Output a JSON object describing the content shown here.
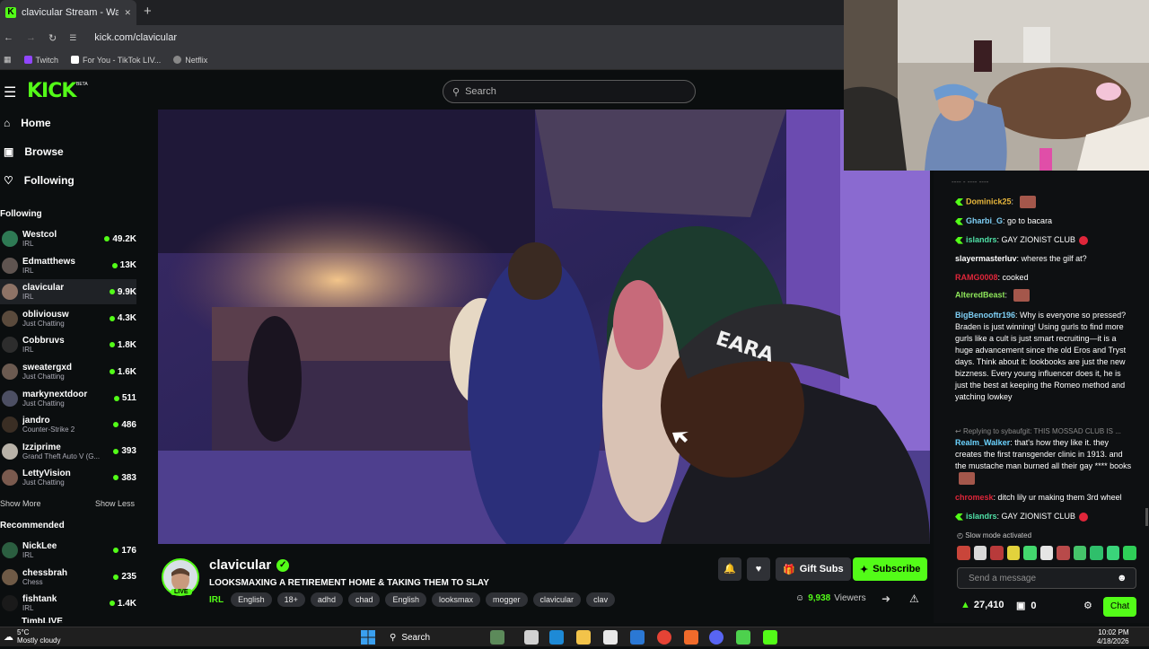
{
  "browser": {
    "tab_title": "clavicular Stream - Watch L",
    "tab_close": "✕",
    "new_tab": "+",
    "url": "kick.com/clavicular",
    "bookmarks": [
      {
        "label": "Twitch",
        "color": "#9146ff"
      },
      {
        "label": "For You - TikTok LIV...",
        "color": "#ffffff"
      },
      {
        "label": "Netflix",
        "color": "#888888"
      }
    ]
  },
  "header": {
    "logo": "KICK",
    "beta": "BETA",
    "search_placeholder": "Search"
  },
  "sidebar": {
    "nav": [
      {
        "label": "Home",
        "icon": "home-icon"
      },
      {
        "label": "Browse",
        "icon": "browse-icon"
      },
      {
        "label": "Following",
        "icon": "heart-icon"
      }
    ],
    "following_title": "Following",
    "following": [
      {
        "name": "Westcol",
        "category": "IRL",
        "viewers": "49.2K",
        "color": "#2e7a54"
      },
      {
        "name": "Edmatthews",
        "category": "IRL",
        "viewers": "13K",
        "color": "#5f5450"
      },
      {
        "name": "clavicular",
        "category": "IRL",
        "viewers": "9.9K",
        "color": "#8e7366"
      },
      {
        "name": "obliviousw",
        "category": "Just Chatting",
        "viewers": "4.3K",
        "color": "#5a4a3c"
      },
      {
        "name": "Cobbruvs",
        "category": "IRL",
        "viewers": "1.8K",
        "color": "#2d2d2d"
      },
      {
        "name": "sweatergxd",
        "category": "Just Chatting",
        "viewers": "1.6K",
        "color": "#6b5a50"
      },
      {
        "name": "markynextdoor",
        "category": "Just Chatting",
        "viewers": "511",
        "color": "#4c4f63"
      },
      {
        "name": "jandro",
        "category": "Counter-Strike 2",
        "viewers": "486",
        "color": "#3a2e24"
      },
      {
        "name": "Izziprime",
        "category": "Grand Theft Auto V (G...",
        "viewers": "393",
        "color": "#b8b2a8"
      },
      {
        "name": "LettyVision",
        "category": "Just Chatting",
        "viewers": "383",
        "color": "#7a5a4e"
      }
    ],
    "show_more": "Show More",
    "show_less": "Show Less",
    "recommended_title": "Recommended",
    "recommended": [
      {
        "name": "NickLee",
        "category": "IRL",
        "viewers": "176",
        "color": "#2b5e40"
      },
      {
        "name": "chessbrah",
        "category": "Chess",
        "viewers": "235",
        "color": "#6f5a46"
      },
      {
        "name": "fishtank",
        "category": "IRL",
        "viewers": "1.4K",
        "color": "#1a1a1a"
      }
    ],
    "partial_item": "TimbLIVE"
  },
  "stream": {
    "channel": "clavicular",
    "live_badge": "LIVE",
    "title": "LOOKSMAXING A RETIREMENT HOME & TAKING THEM TO SLAY",
    "category": "IRL",
    "tags": [
      "English",
      "18+",
      "adhd",
      "chad",
      "English",
      "looksmax",
      "mogger",
      "clavicular",
      "clav"
    ],
    "gift_subs": "Gift Subs",
    "subscribe": "Subscribe",
    "viewers": "9,938",
    "viewers_label": "Viewers",
    "cap_text": "EARA"
  },
  "chat": {
    "top_fragment": "---- -  ----  ----",
    "messages": [
      {
        "user": "Dominick25",
        "color": "#e8b73c",
        "badge": true,
        "text": "",
        "emote": true
      },
      {
        "user": "Gharbi_G",
        "color": "#7ecff5",
        "badge": true,
        "text": "go to bacara"
      },
      {
        "user": "islandrs",
        "color": "#4fe0a6",
        "badge": true,
        "text": "GAY ZIONIST CLUB",
        "small_emote": true
      },
      {
        "user": "slayermasterluv",
        "color": "#ffffff",
        "badge": false,
        "text": "wheres the gilf at?"
      },
      {
        "user": "RAMG0008",
        "color": "#e0263a",
        "badge": false,
        "text": "cooked"
      },
      {
        "user": "AlteredBeast",
        "color": "#8ee55a",
        "badge": false,
        "text": "",
        "emote": true
      },
      {
        "user": "BigBenooftr196",
        "color": "#7ecff5",
        "badge": false,
        "text": "Why is everyone so pressed? Braden is just winning! Using gurls to find more gurls like a cult is just smart recruiting—it is a huge advancement since the old Eros and Tryst days. Think about it: lookbooks are just the new bizzness. Every young influencer does it, he is just the best at keeping the Romeo method and yatching lowkey"
      },
      {
        "reply": "Replying to sybaufgit: THIS MOSSAD CLUB IS ..."
      },
      {
        "user": "Realm_Walker",
        "color": "#6bd3ff",
        "badge": false,
        "text": "that's how they like it. they creates the first transgender clinic in 1913. and the mustache man burned all their gay **** books",
        "emote": true
      },
      {
        "user": "chromesk",
        "color": "#e0263a",
        "badge": false,
        "text": "ditch lily ur making them 3rd wheel"
      },
      {
        "user": "islandrs",
        "color": "#4fe0a6",
        "badge": true,
        "text": "GAY ZIONIST CLUB",
        "small_emote": true
      }
    ],
    "slow_mode": "Slow mode activated",
    "emotes": [
      "#c9453a",
      "#d9d9d9",
      "#b83a3a",
      "#e2d23c",
      "#43d86e",
      "#e5e5e5",
      "#b84a4a",
      "#45c46a",
      "#2fbf6b",
      "#3ad47a",
      "#2fcf58"
    ],
    "input_placeholder": "Send a message",
    "points": "27,410",
    "drops": "0",
    "chat_button": "Chat"
  },
  "taskbar": {
    "temp": "5°C",
    "weather": "Mostly cloudy",
    "search": "Search",
    "time": "10:02 PM",
    "date": "4/18/2026",
    "apps": [
      {
        "name": "file-icon",
        "color": "#d0d0d0"
      },
      {
        "name": "edge-icon",
        "color": "#1e8ad6"
      },
      {
        "name": "folder-icon",
        "color": "#f2c34a"
      },
      {
        "name": "store-icon",
        "color": "#e8e8e8"
      },
      {
        "name": "mail-icon",
        "color": "#2b78d4"
      },
      {
        "name": "chrome-icon",
        "color": "#e54335"
      },
      {
        "name": "brave-icon",
        "color": "#f06b2b"
      },
      {
        "name": "discord-icon",
        "color": "#5865f2"
      },
      {
        "name": "xbox-icon",
        "color": "#4dd14d"
      },
      {
        "name": "kick-icon",
        "color": "#53fc18"
      }
    ]
  }
}
